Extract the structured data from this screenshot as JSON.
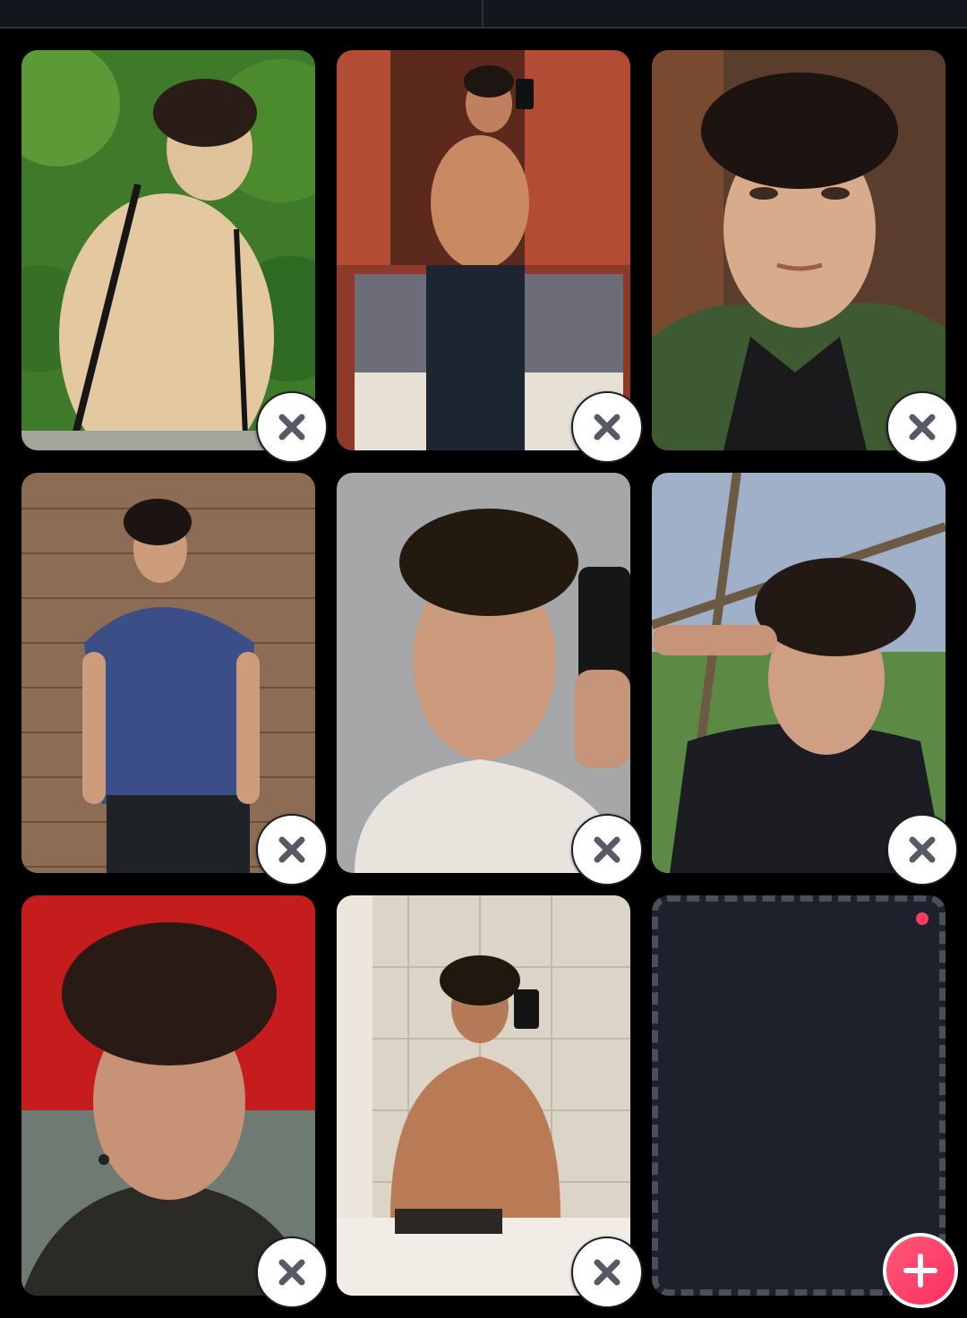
{
  "header": {
    "tabs": [
      {
        "name": "left-tab",
        "label": ""
      },
      {
        "name": "right-tab",
        "label": ""
      }
    ]
  },
  "photos": [
    {
      "icon": "photo-shirtless-outdoor",
      "remove_icon": "close-icon"
    },
    {
      "icon": "photo-mirror-selfie-bedroom",
      "remove_icon": "close-icon"
    },
    {
      "icon": "photo-selfie-green-hoodie",
      "remove_icon": "close-icon"
    },
    {
      "icon": "photo-blue-tshirt-wood-wall",
      "remove_icon": "close-icon"
    },
    {
      "icon": "photo-mirror-selfie-white-tshirt",
      "remove_icon": "close-icon"
    },
    {
      "icon": "photo-selfie-black-tshirt-outdoor",
      "remove_icon": "close-icon"
    },
    {
      "icon": "photo-selfie-red-tent",
      "remove_icon": "close-icon"
    },
    {
      "icon": "photo-mirror-selfie-bathroom",
      "remove_icon": "close-icon"
    }
  ],
  "empty_slot": {
    "add_icon": "plus-icon",
    "notification_dot": true
  },
  "colors": {
    "background": "#000000",
    "empty_slot_bg": "#1e212b",
    "add_button": "#fd3b66",
    "remove_button_bg": "#ffffff",
    "remove_icon": "#565a64"
  }
}
